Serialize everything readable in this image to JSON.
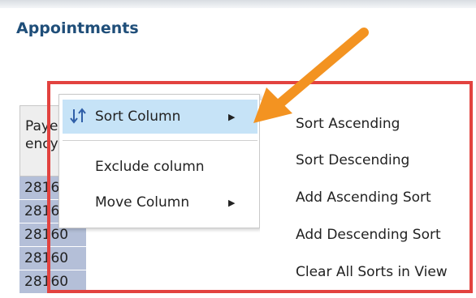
{
  "page": {
    "title": "Appointments"
  },
  "table": {
    "header": "Payer Agency",
    "rows": [
      "28160",
      "28160",
      "28160",
      "28160",
      "28160"
    ]
  },
  "context_menu": {
    "items": [
      {
        "label": "Sort Column",
        "icon": "sort-arrows-icon",
        "submenu": true,
        "active": true
      },
      {
        "label": "Exclude column",
        "submenu": false
      },
      {
        "label": "Move Column",
        "submenu": true
      }
    ]
  },
  "sort_submenu": {
    "items": [
      "Sort Ascending",
      "Sort Descending",
      "Add Ascending Sort",
      "Add Descending Sort",
      "Clear All Sorts in View"
    ]
  },
  "colors": {
    "title": "#1f4e79",
    "active_item": "#c6e3f7",
    "cell_fill": "#b4bfd8",
    "annotation_box": "#e2423f",
    "annotation_arrow": "#f39321"
  }
}
